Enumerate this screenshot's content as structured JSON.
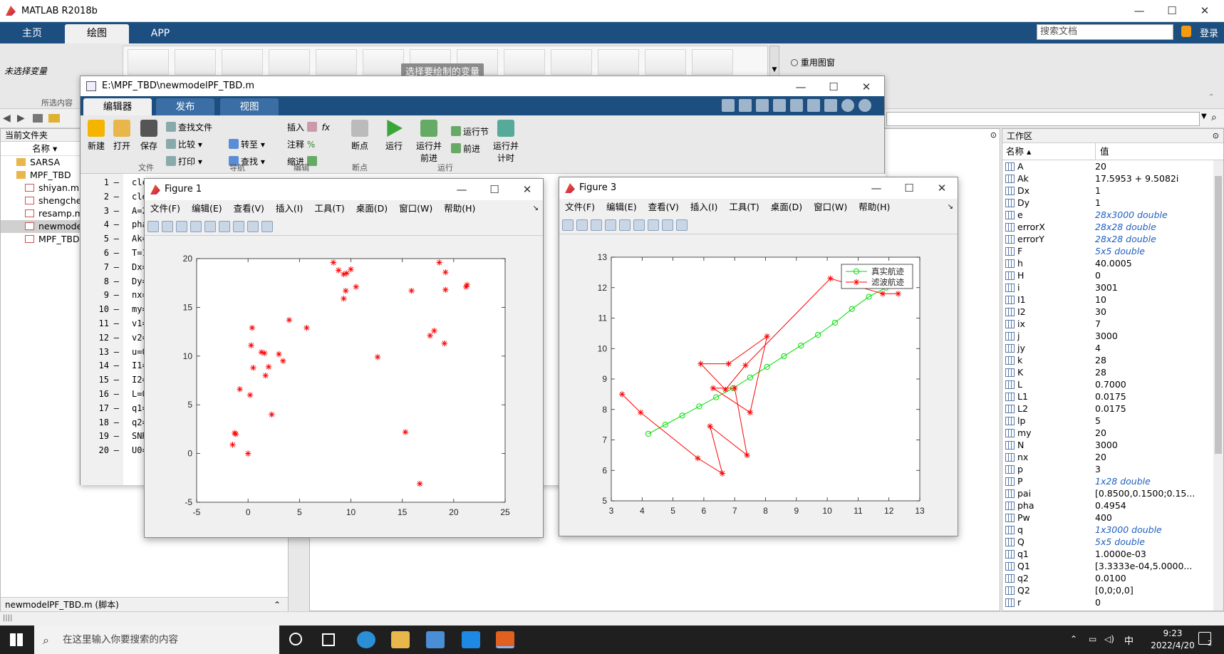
{
  "app": {
    "title": "MATLAB R2018b"
  },
  "ribbon": {
    "tabs": [
      "主页",
      "绘图",
      "APP"
    ],
    "search_placeholder": "搜索文档",
    "login": "登录",
    "no_var": "未选择变量",
    "selection_label": "所选内容",
    "gallery_hint": "选择要绘制的变量",
    "reuse_figure": "重用图窗"
  },
  "filebrowser": {
    "title": "当前文件夹",
    "col_name": "名称",
    "items": [
      {
        "label": "SARSA",
        "kind": "folder"
      },
      {
        "label": "MPF_TBD",
        "kind": "folder"
      },
      {
        "label": "shiyan.m",
        "kind": "file"
      },
      {
        "label": "shengche",
        "kind": "file"
      },
      {
        "label": "resamp.m",
        "kind": "file"
      },
      {
        "label": "newmode",
        "kind": "file"
      },
      {
        "label": "MPF_TBD.",
        "kind": "file"
      }
    ],
    "detail": "newmodelPF_TBD.m  (脚本)"
  },
  "editor": {
    "title": "E:\\MPF_TBD\\newmodelPF_TBD.m",
    "tabs": [
      "编辑器",
      "发布",
      "视图"
    ],
    "buttons": {
      "new": "新建",
      "open": "打开",
      "save": "保存",
      "findfile": "查找文件",
      "compare": "比较",
      "print": "打印",
      "goto": "转至",
      "find": "查找",
      "insert": "插入",
      "comment": "注释",
      "indent": "缩进",
      "breakpoint": "断点",
      "run": "运行",
      "runadvance": "运行并\n前进",
      "runsection": "运行节",
      "advance": "前进",
      "runtime": "运行并\n计时"
    },
    "groups": [
      "文件",
      "导航",
      "编辑",
      "断点",
      "运行"
    ],
    "lines": [
      "clc",
      "cle",
      "A=2",
      "pha",
      "Ak=",
      "T=1",
      "Dx=",
      "Dy=",
      "nx=",
      "my=",
      "v1=",
      "v2=",
      "u=0",
      "I1=",
      "I2=",
      "L=0",
      "q1=",
      "q2=",
      "SNR",
      "U0="
    ]
  },
  "figure1": {
    "title": "Figure 1",
    "menu": [
      "文件(F)",
      "编辑(E)",
      "查看(V)",
      "插入(I)",
      "工具(T)",
      "桌面(D)",
      "窗口(W)",
      "帮助(H)"
    ]
  },
  "figure3": {
    "title": "Figure 3",
    "menu": [
      "文件(F)",
      "编辑(E)",
      "查看(V)",
      "插入(I)",
      "工具(T)",
      "桌面(D)",
      "窗口(W)",
      "帮助(H)"
    ]
  },
  "workspace": {
    "title": "工作区",
    "col_name": "名称",
    "col_value": "值",
    "rows": [
      {
        "name": "A",
        "value": "20",
        "italic": false
      },
      {
        "name": "Ak",
        "value": "17.5953 + 9.5082i",
        "italic": false
      },
      {
        "name": "Dx",
        "value": "1",
        "italic": false
      },
      {
        "name": "Dy",
        "value": "1",
        "italic": false
      },
      {
        "name": "e",
        "value": "28x3000 double",
        "italic": true
      },
      {
        "name": "errorX",
        "value": "28x28 double",
        "italic": true
      },
      {
        "name": "errorY",
        "value": "28x28 double",
        "italic": true
      },
      {
        "name": "F",
        "value": "5x5 double",
        "italic": true
      },
      {
        "name": "h",
        "value": "40.0005",
        "italic": false
      },
      {
        "name": "H",
        "value": "0",
        "italic": false
      },
      {
        "name": "i",
        "value": "3001",
        "italic": false
      },
      {
        "name": "I1",
        "value": "10",
        "italic": false
      },
      {
        "name": "I2",
        "value": "30",
        "italic": false
      },
      {
        "name": "ix",
        "value": "7",
        "italic": false
      },
      {
        "name": "j",
        "value": "3000",
        "italic": false
      },
      {
        "name": "jy",
        "value": "4",
        "italic": false
      },
      {
        "name": "k",
        "value": "28",
        "italic": false
      },
      {
        "name": "K",
        "value": "28",
        "italic": false
      },
      {
        "name": "L",
        "value": "0.7000",
        "italic": false
      },
      {
        "name": "L1",
        "value": "0.0175",
        "italic": false
      },
      {
        "name": "L2",
        "value": "0.0175",
        "italic": false
      },
      {
        "name": "lp",
        "value": "5",
        "italic": false
      },
      {
        "name": "my",
        "value": "20",
        "italic": false
      },
      {
        "name": "N",
        "value": "3000",
        "italic": false
      },
      {
        "name": "nx",
        "value": "20",
        "italic": false
      },
      {
        "name": "p",
        "value": "3",
        "italic": false
      },
      {
        "name": "P",
        "value": "1x28 double",
        "italic": true
      },
      {
        "name": "pai",
        "value": "[0.8500,0.1500;0.15...",
        "italic": false
      },
      {
        "name": "pha",
        "value": "0.4954",
        "italic": false
      },
      {
        "name": "Pw",
        "value": "400",
        "italic": false
      },
      {
        "name": "q",
        "value": "1x3000 double",
        "italic": true
      },
      {
        "name": "Q",
        "value": "5x5 double",
        "italic": true
      },
      {
        "name": "q1",
        "value": "1.0000e-03",
        "italic": false
      },
      {
        "name": "Q1",
        "value": "[3.3333e-04,5.0000...",
        "italic": false
      },
      {
        "name": "q2",
        "value": "0.0100",
        "italic": false
      },
      {
        "name": "Q2",
        "value": "[0,0;0,0]",
        "italic": false
      },
      {
        "name": "r",
        "value": "0",
        "italic": false
      }
    ]
  },
  "taskbar": {
    "search_placeholder": "在这里输入你要搜索的内容",
    "ime": "中",
    "time": "9:23",
    "date": "2022/4/20",
    "notif_count": "2"
  },
  "chart_data": [
    {
      "type": "scatter",
      "xlim": [
        -5,
        25
      ],
      "ylim": [
        -5,
        20
      ],
      "xticks": [
        -5,
        0,
        5,
        10,
        15,
        20,
        25
      ],
      "yticks": [
        -5,
        0,
        5,
        10,
        15,
        20
      ],
      "series": [
        {
          "marker": "*",
          "color": "#ff0000",
          "points": [
            [
              8.3,
              19.6
            ],
            [
              8.8,
              18.8
            ],
            [
              9.3,
              18.4
            ],
            [
              9.6,
              18.5
            ],
            [
              10,
              18.9
            ],
            [
              9.3,
              15.9
            ],
            [
              9.5,
              16.7
            ],
            [
              10.5,
              17.1
            ],
            [
              4,
              13.7
            ],
            [
              5.7,
              12.9
            ],
            [
              0.4,
              12.9
            ],
            [
              0.3,
              11.1
            ],
            [
              1.3,
              10.4
            ],
            [
              1.6,
              10.3
            ],
            [
              3,
              10.2
            ],
            [
              3.4,
              9.5
            ],
            [
              2,
              8.9
            ],
            [
              0.5,
              8.8
            ],
            [
              1.7,
              8
            ],
            [
              -0.8,
              6.6
            ],
            [
              0.2,
              6
            ],
            [
              2.3,
              4
            ],
            [
              -1.3,
              2.1
            ],
            [
              -1.2,
              2
            ],
            [
              -1.5,
              0.9
            ],
            [
              0,
              0
            ],
            [
              12.6,
              9.9
            ],
            [
              15.9,
              16.7
            ],
            [
              18.6,
              19.6
            ],
            [
              19.2,
              18.6
            ],
            [
              21.3,
              17.3
            ],
            [
              21.2,
              17.1
            ],
            [
              19.2,
              16.8
            ],
            [
              18.1,
              12.6
            ],
            [
              17.7,
              12.1
            ],
            [
              19.1,
              11.3
            ],
            [
              15.3,
              2.2
            ],
            [
              16.7,
              -3.1
            ]
          ]
        }
      ]
    },
    {
      "type": "line",
      "xlim": [
        3,
        13
      ],
      "ylim": [
        5,
        13
      ],
      "xticks": [
        3,
        4,
        5,
        6,
        7,
        8,
        9,
        10,
        11,
        12,
        13
      ],
      "yticks": [
        5,
        6,
        7,
        8,
        9,
        10,
        11,
        12,
        13
      ],
      "legend": "top-right",
      "series": [
        {
          "name": "真实航迹",
          "color": "#00dd00",
          "marker": "o",
          "x": [
            4.2,
            4.75,
            5.3,
            5.85,
            6.4,
            6.95,
            7.5,
            8.05,
            8.6,
            9.15,
            9.7,
            10.25,
            10.8,
            11.35,
            11.9,
            12.45
          ],
          "y": [
            7.2,
            7.5,
            7.8,
            8.1,
            8.4,
            8.7,
            9.05,
            9.4,
            9.75,
            10.1,
            10.45,
            10.85,
            11.3,
            11.7,
            12.0,
            12.2
          ]
        },
        {
          "name": "滤波航迹",
          "color": "#ff0000",
          "marker": "*",
          "x": [
            3.35,
            3.95,
            5.8,
            6.6,
            6.2,
            7.4,
            7.0,
            6.3,
            7.5,
            8.05,
            6.8,
            5.9,
            6.7,
            7.35,
            10.1,
            11.8,
            12.3
          ],
          "y": [
            8.5,
            7.9,
            6.4,
            5.9,
            7.45,
            6.5,
            8.7,
            8.7,
            7.9,
            10.4,
            9.5,
            9.5,
            8.65,
            9.45,
            12.3,
            11.8,
            11.8
          ]
        }
      ]
    }
  ]
}
